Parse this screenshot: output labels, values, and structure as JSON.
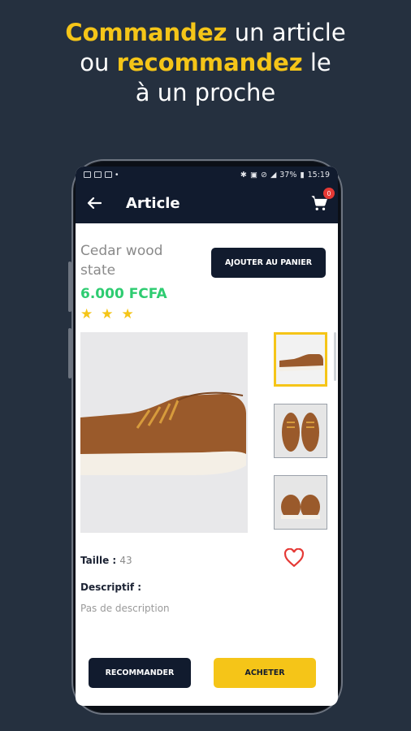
{
  "headline": {
    "line1_highlight": "Commandez",
    "line1_rest": " un article",
    "line2_start": "ou ",
    "line2_highlight": "recommandez",
    "line2_rest": " le",
    "line3": "à un proche"
  },
  "statusbar": {
    "battery": "37%",
    "time": "15:19"
  },
  "appbar": {
    "title": "Article",
    "cart_count": "0"
  },
  "product": {
    "name": "Cedar wood state",
    "price": "6.000 FCFA",
    "rating": 3,
    "add_to_cart_label": "AJOUTER AU PANIER",
    "size_label": "Taille :",
    "size_value": "43",
    "description_label": "Descriptif :",
    "description_text": "Pas de description"
  },
  "actions": {
    "recommend_label": "RECOMMANDER",
    "buy_label": "ACHETER"
  },
  "colors": {
    "background": "#25303f",
    "navy": "#111b2e",
    "accent_yellow": "#f5c518",
    "price_green": "#2ecc71",
    "heart_red": "#e53935"
  }
}
